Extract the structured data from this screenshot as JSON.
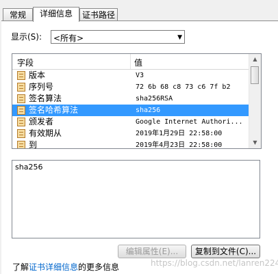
{
  "tabs": [
    "常规",
    "详细信息",
    "证书路径"
  ],
  "show": {
    "label": "显示(S):",
    "value": "<所有>"
  },
  "list": {
    "headers": [
      "字段",
      "值"
    ],
    "rows": [
      {
        "field": "版本",
        "value": "V3",
        "selected": false
      },
      {
        "field": "序列号",
        "value": "72 6b 68 c8 73 c6 7f b2",
        "selected": false
      },
      {
        "field": "签名算法",
        "value": "sha256RSA",
        "selected": false
      },
      {
        "field": "签名哈希算法",
        "value": "sha256",
        "selected": true
      },
      {
        "field": "颁发者",
        "value": "Google Internet Authori...",
        "selected": false
      },
      {
        "field": "有效期从",
        "value": "2019年1月29日 22:58:00",
        "selected": false
      },
      {
        "field": "到",
        "value": "2019年4月23日 22:58:00",
        "selected": false
      }
    ]
  },
  "detail_text": "sha256",
  "buttons": {
    "edit": "编辑属性(E)...",
    "copy": "复制到文件(C)..."
  },
  "more_info": {
    "prefix": "了解",
    "link": "证书详细信息",
    "suffix": "的更多信息"
  },
  "watermark": "https://blog.csdn.net/lanren224",
  "colors": {
    "selection": "#3399ff",
    "link": "#0066cc"
  }
}
